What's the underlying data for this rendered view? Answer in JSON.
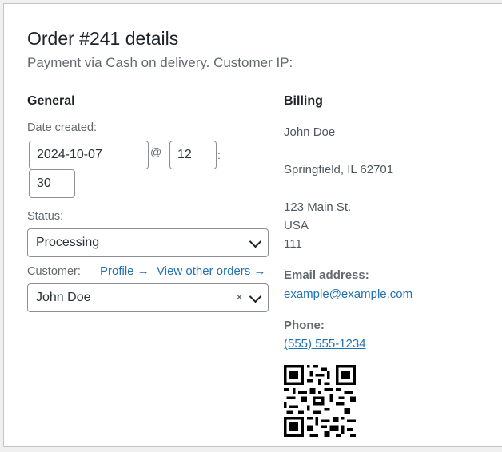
{
  "order": {
    "title": "Order #241 details",
    "subtitle": "Payment via Cash on delivery. Customer IP:"
  },
  "general": {
    "heading": "General",
    "date_label": "Date created:",
    "date_value": "2024-10-07",
    "at_sep": "@",
    "hour_value": "12",
    "colon_sep": ":",
    "minute_value": "30",
    "status_label": "Status:",
    "status_value": "Processing",
    "customer_label": "Customer:",
    "profile_link": "Profile →",
    "other_orders_link": "View other orders →",
    "customer_value": "John Doe",
    "clear_glyph": "×"
  },
  "billing": {
    "heading": "Billing",
    "name": "John Doe",
    "city": "Springfield, IL 62701",
    "street": "123 Main St.",
    "country": "USA",
    "code": "111",
    "email_label": "Email address:",
    "email": "example@example.com",
    "phone_label": "Phone:",
    "phone": "(555) 555-1234"
  },
  "colors": {
    "link": "#2271b1",
    "border": "#8c8f94",
    "text": "#1d2327",
    "muted": "#646970"
  },
  "icons": [
    "chevron-down-icon",
    "clear-icon",
    "qr-code-icon"
  ]
}
